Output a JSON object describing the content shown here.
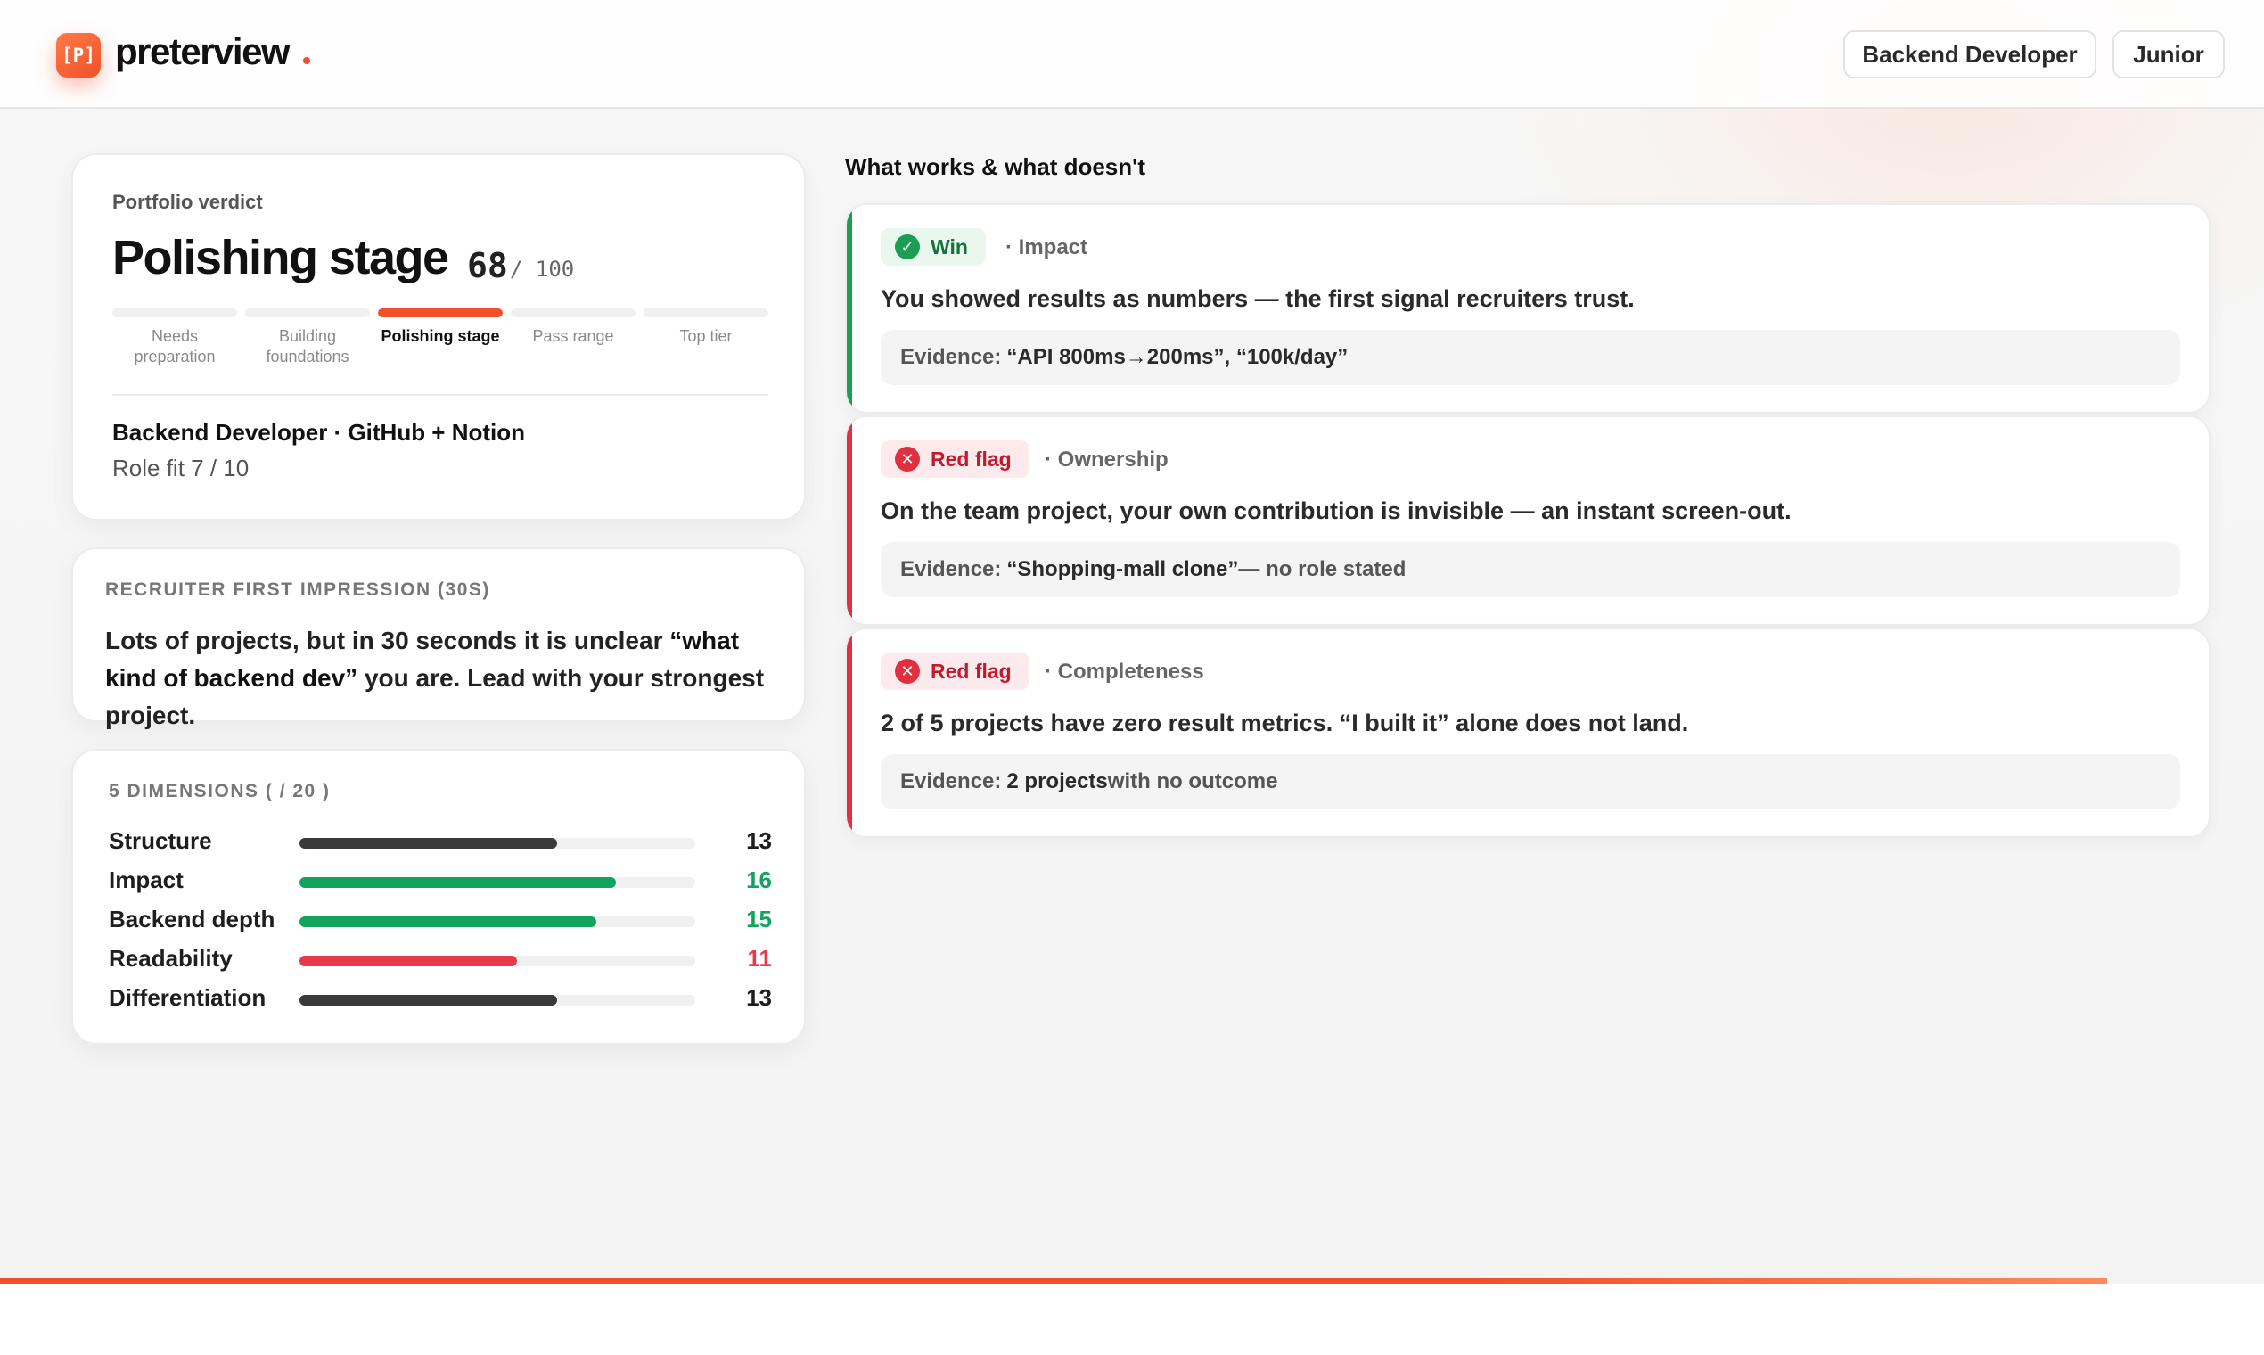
{
  "header": {
    "logo_mark": "[P]",
    "logo_text": "preterview",
    "role": "Backend Developer",
    "level": "Junior"
  },
  "verdict": {
    "label": "Portfolio verdict",
    "title": "Polishing stage",
    "score": "68",
    "score_max": "/ 100",
    "stages": [
      {
        "label": "Needs preparation"
      },
      {
        "label": "Building foundations"
      },
      {
        "label": "Polishing stage"
      },
      {
        "label": "Pass range"
      },
      {
        "label": "Top tier"
      }
    ],
    "active_stage": 2,
    "meta": "Backend Developer · GitHub + Notion",
    "fit": "Role fit 7 / 10"
  },
  "impression": {
    "label": "RECRUITER FIRST IMPRESSION (30S)",
    "text_a": "Lots of projects, but in 30 seconds it is unclear ",
    "text_em": "“what kind of backend dev”",
    "text_b": " you are. Lead with your strongest project."
  },
  "dimensions": {
    "label": "5 DIMENSIONS ( / 20 )",
    "max": 20,
    "items": [
      {
        "name": "Structure",
        "value": 13,
        "color": "#3a3a3a"
      },
      {
        "name": "Impact",
        "value": 16,
        "color": "#14a35c"
      },
      {
        "name": "Backend depth",
        "value": 15,
        "color": "#14a35c"
      },
      {
        "name": "Readability",
        "value": 11,
        "color": "#e8394a"
      },
      {
        "name": "Differentiation",
        "value": 13,
        "color": "#3a3a3a"
      }
    ]
  },
  "findings": {
    "title": "What works & what doesn't",
    "evidence_prefix": "Evidence:",
    "items": [
      {
        "type": "win",
        "badge": "Win",
        "category": "· Impact",
        "text": "You showed results as numbers — the first signal recruiters trust.",
        "evidence": "“API 800ms→200ms”, “100k/day”",
        "evidence_tail": "",
        "accent": "#1a9e52"
      },
      {
        "type": "flag",
        "badge": "Red flag",
        "category": "· Ownership",
        "text": "On the team project, your own contribution is invisible — an instant screen-out.",
        "evidence": "“Shopping-mall clone”",
        "evidence_tail": " — no role stated",
        "accent": "#e0303f"
      },
      {
        "type": "flag",
        "badge": "Red flag",
        "category": "· Completeness",
        "text": "2 of 5 projects have zero result metrics. “I built it” alone does not land.",
        "evidence": "2 projects",
        "evidence_tail": " with no outcome",
        "accent": "#e0303f"
      }
    ]
  }
}
